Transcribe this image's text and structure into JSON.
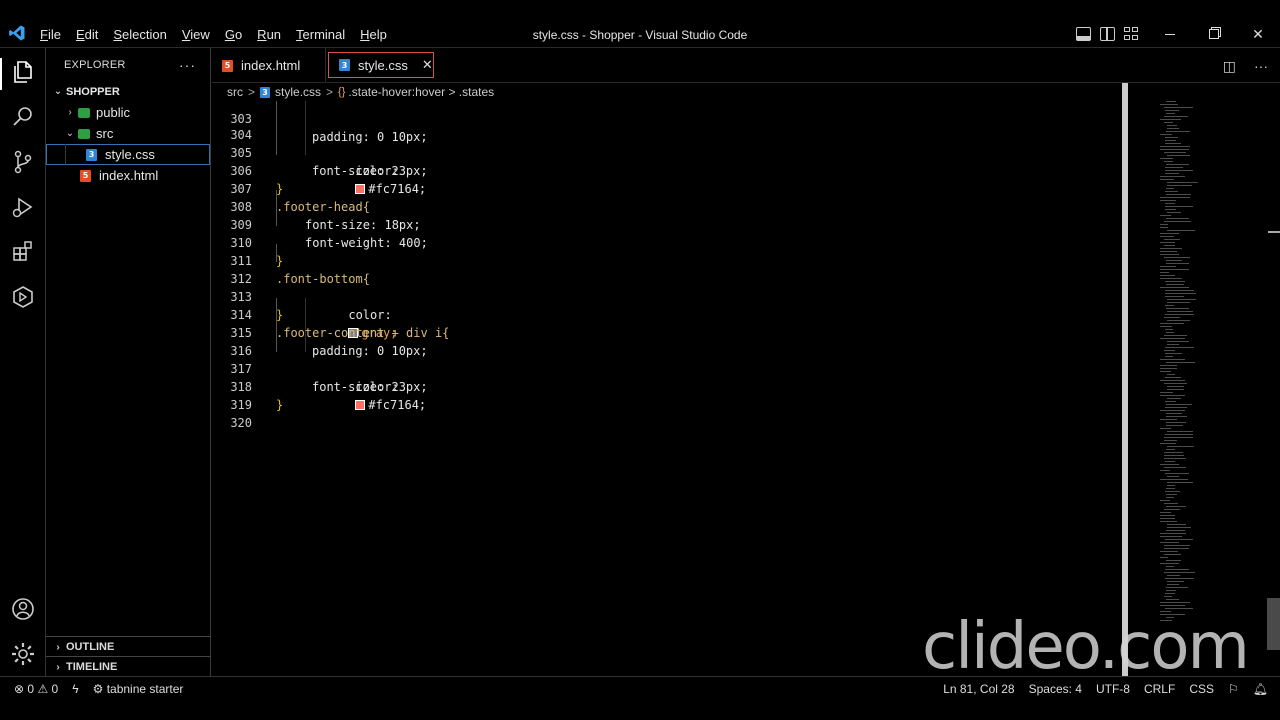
{
  "window": {
    "title": "style.css - Shopper - Visual Studio Code",
    "menu": [
      "File",
      "Edit",
      "Selection",
      "View",
      "Go",
      "Run",
      "Terminal",
      "Help"
    ]
  },
  "sidebar": {
    "title": "EXPLORER",
    "more": "···",
    "root": "SHOPPER",
    "items": [
      {
        "label": "public",
        "kind": "folder",
        "icon_color": "#2ea043"
      },
      {
        "label": "src",
        "kind": "folder",
        "icon_color": "#2ea043"
      },
      {
        "label": "style.css",
        "kind": "file",
        "icon_color": "#2f86d6",
        "icon": "css-file-icon"
      },
      {
        "label": "index.html",
        "kind": "file",
        "icon_color": "#e44d26",
        "icon": "html-file-icon"
      }
    ],
    "sections": [
      "OUTLINE",
      "TIMELINE"
    ]
  },
  "tabs": [
    {
      "label": "index.html",
      "icon": "html-file-icon"
    },
    {
      "label": "style.css",
      "icon": "css-file-icon",
      "close": "✕"
    }
  ],
  "breadcrumb": {
    "folder": "src",
    "file": "style.css",
    "symbol": ".state-hover:hover > .states"
  },
  "code": {
    "lines": [
      {
        "n": "303",
        "text": "padding: 0 10px;"
      },
      {
        "n": "304",
        "text": "color:",
        "swatch": "#fc7164",
        "value": "#fc7164;"
      },
      {
        "n": "305",
        "text": "font-size: 23px;"
      },
      {
        "n": "306",
        "text": "}"
      },
      {
        "n": "307",
        "text": ".footer-head{"
      },
      {
        "n": "308",
        "text": "font-size: 18px;"
      },
      {
        "n": "309",
        "text": "font-weight: 400;"
      },
      {
        "n": "310",
        "text": "}"
      },
      {
        "n": "311",
        "text": ".font-bottom{"
      },
      {
        "n": "312",
        "text": "color:",
        "swatch": "#808080",
        "value": "gray;"
      },
      {
        "n": "313",
        "text": "}"
      },
      {
        "n": "314",
        "text": ".footer-content + div i{"
      },
      {
        "n": "315",
        "text": "padding: 0 10px;"
      },
      {
        "n": "316",
        "text": "color:",
        "swatch": "#fc7164",
        "value": "#fc7164;"
      },
      {
        "n": "317",
        "text": "font-size: 23px;"
      },
      {
        "n": "318",
        "text": "}"
      },
      {
        "n": "319",
        "text": ""
      },
      {
        "n": "320",
        "text": ""
      }
    ]
  },
  "status": {
    "errors": "0",
    "warnings": "0",
    "tabnine": "tabnine starter",
    "position": "Ln 81, Col 28",
    "spaces": "Spaces: 4",
    "encoding": "UTF-8",
    "eol": "CRLF",
    "language": "CSS"
  },
  "watermark": "clideo.com"
}
